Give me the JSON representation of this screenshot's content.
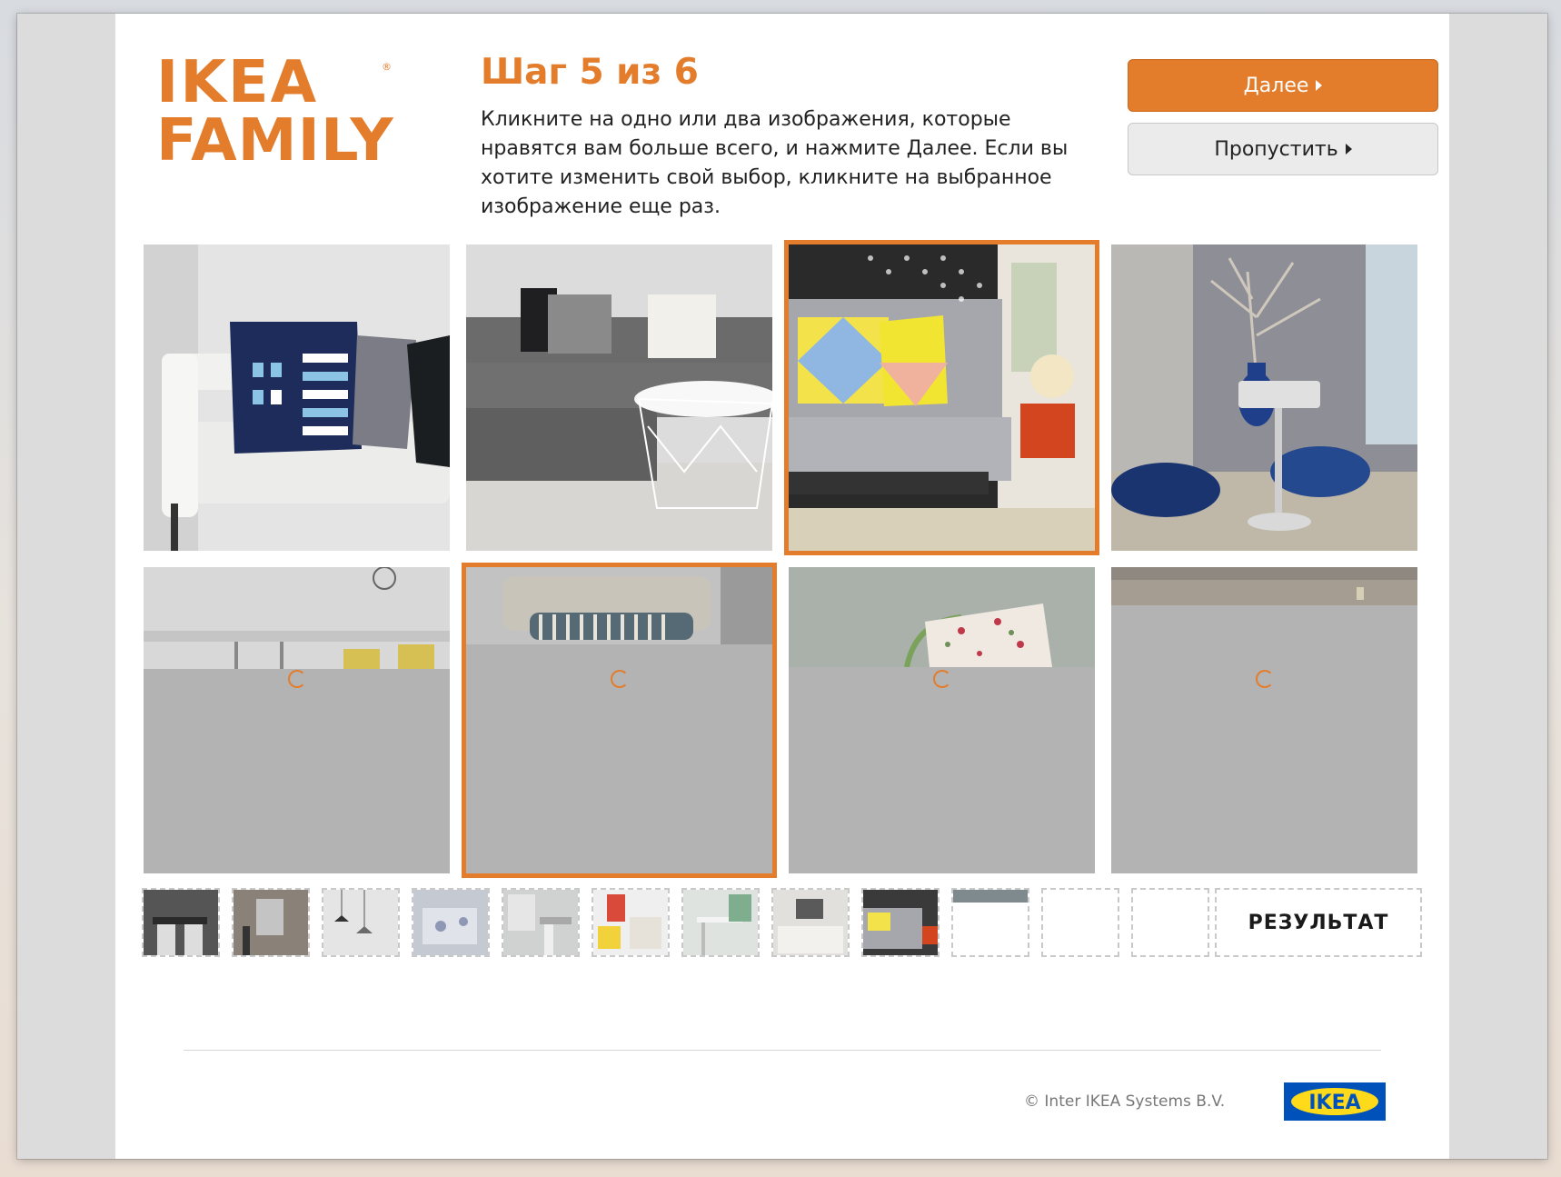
{
  "brand": {
    "logo_line1": "IKEA",
    "logo_line2": "FAMILY",
    "registered": "®",
    "accent_color": "#e37d2c"
  },
  "header": {
    "step_title": "Шаг 5 из 6",
    "instructions": "Кликните на одно или два изображения, которые нравятся вам больше всего, и нажмите Далее. Если вы хотите изменить свой выбор, кликните на выбранное изображение еще раз."
  },
  "buttons": {
    "next_label": "Далее",
    "skip_label": "Пропустить"
  },
  "grid": {
    "tiles": [
      {
        "name": "white-sofa-cushions",
        "selected": false,
        "loading": false
      },
      {
        "name": "grey-corner-sofa-wire-table",
        "selected": false,
        "loading": false
      },
      {
        "name": "grey-sofa-bed-geometric-cushions",
        "selected": true,
        "loading": false
      },
      {
        "name": "blue-glass-vases-lamp",
        "selected": false,
        "loading": false
      },
      {
        "name": "kitchen-counter",
        "selected": false,
        "loading": true
      },
      {
        "name": "striped-cushion-chair",
        "selected": true,
        "loading": true
      },
      {
        "name": "floral-cushion-chair",
        "selected": false,
        "loading": true
      },
      {
        "name": "bedroom-headboard",
        "selected": false,
        "loading": true
      }
    ]
  },
  "progress": {
    "thumbnails_filled": 10,
    "thumbnails_empty": 2,
    "result_label": "РЕЗУЛЬТАТ"
  },
  "footer": {
    "copyright": "© Inter IKEA Systems B.V.",
    "ikea_logo_text": "IKEA",
    "ikea_logo_blue": "#0051ba",
    "ikea_logo_yellow": "#ffda1a"
  }
}
